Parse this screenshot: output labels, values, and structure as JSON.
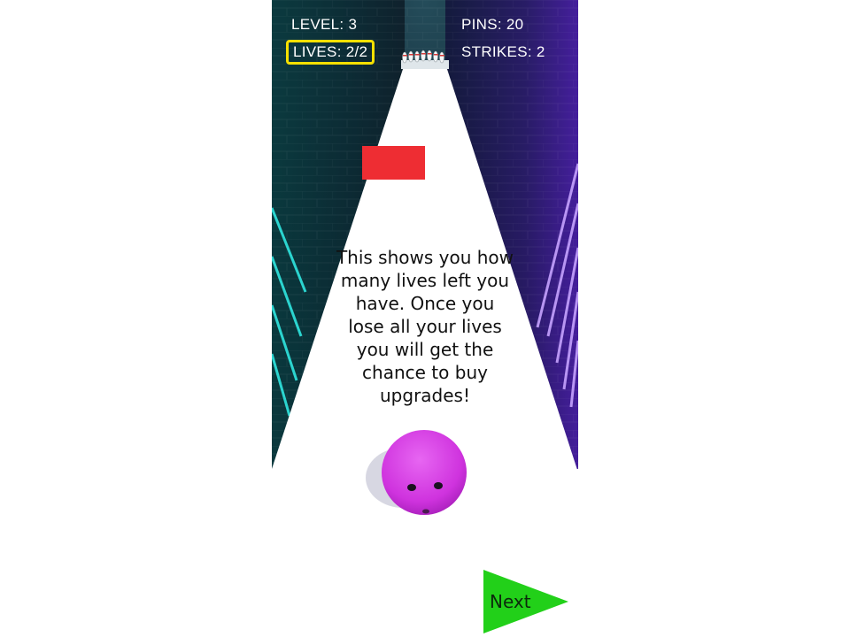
{
  "hud": {
    "level_text": "LEVEL: 3",
    "pins_text": "PINS: 20",
    "lives_text": "LIVES: 2/2",
    "strikes_text": "STRIKES: 2"
  },
  "tutorial": {
    "message": "This shows you how many lives left you have. Once you lose all your lives you will get the chance to buy upgrades!"
  },
  "next_button": {
    "label": "Next"
  },
  "scene": {
    "ball_icon": "bowling-ball-face-icon",
    "pins_icon": "bowling-pins-icon",
    "obstacle_icon": "red-block-icon"
  },
  "colors": {
    "highlight_border": "#f5e000",
    "lane": "#ffffff",
    "ball": "#d233e0",
    "obstacle": "#ee2d33",
    "next_button": "#22d019",
    "neon_cyan": "#2fe6e0",
    "neon_purple": "#a455ff"
  }
}
